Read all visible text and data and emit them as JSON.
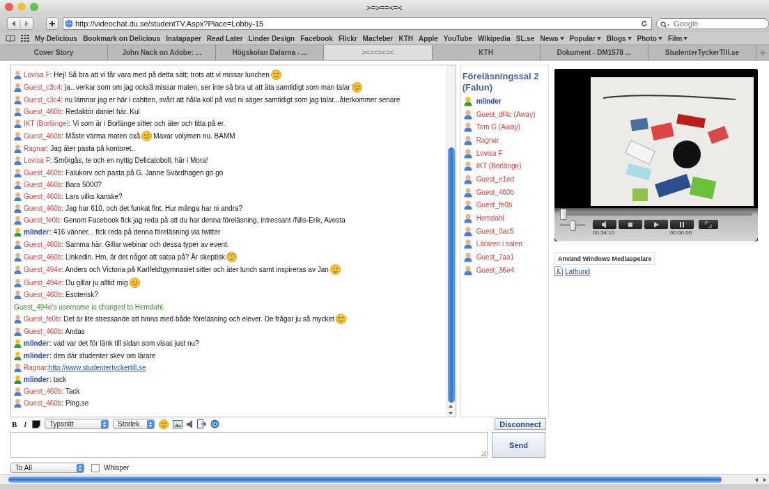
{
  "window": {
    "title": ">=>==<=<"
  },
  "toolbar": {
    "url": "http://videochat.du.se/studentTV.Aspx?Place=Lobby-15",
    "search_placeholder": "Google"
  },
  "bookmarks": [
    {
      "label": "My Delicious",
      "menu": false
    },
    {
      "label": "Bookmark on Delicious",
      "menu": false
    },
    {
      "label": "Instapaper",
      "menu": false
    },
    {
      "label": "Read Later",
      "menu": false
    },
    {
      "label": "Linder Design",
      "menu": false
    },
    {
      "label": "Facebook",
      "menu": false
    },
    {
      "label": "Flickr",
      "menu": false
    },
    {
      "label": "Macfeber",
      "menu": false
    },
    {
      "label": "KTH",
      "menu": false
    },
    {
      "label": "Apple",
      "menu": false
    },
    {
      "label": "YouTube",
      "menu": false
    },
    {
      "label": "Wikipedia",
      "menu": false
    },
    {
      "label": "SL.se",
      "menu": false
    },
    {
      "label": "News",
      "menu": true
    },
    {
      "label": "Popular",
      "menu": true
    },
    {
      "label": "Blogs",
      "menu": true
    },
    {
      "label": "Photo",
      "menu": true
    },
    {
      "label": "Film",
      "menu": true
    }
  ],
  "tabs": [
    {
      "label": "Cover Story",
      "selected": false
    },
    {
      "label": "John Nack on Adobe: ...",
      "selected": false
    },
    {
      "label": "Högskolan Dalarna - ...",
      "selected": false
    },
    {
      "label": ">=>==<=<",
      "selected": true
    },
    {
      "label": "KTH",
      "selected": false
    },
    {
      "label": "Dokument - DM1578 ...",
      "selected": false
    },
    {
      "label": "StudenterTyckerTill.se",
      "selected": false
    }
  ],
  "chat": {
    "messages": [
      {
        "kind": "guest",
        "user": "Lovisa F",
        "parts": [
          {
            "kind": "text",
            "text": ": Hej! Så bra att vi får vara med på detta sätt; trots att vi missar lunchen"
          },
          {
            "kind": "sad"
          }
        ]
      },
      {
        "kind": "guest",
        "user": "Guest_c3c4",
        "parts": [
          {
            "kind": "text",
            "text": ": ja...verkar som om jag också missar maten, ser inte så bra ut att äta samtidigt som man talar"
          },
          {
            "kind": "wink"
          }
        ]
      },
      {
        "kind": "guest",
        "user": "Guest_c3c4",
        "parts": [
          {
            "kind": "text",
            "text": ": nu lämnar jag er här i cahtten, svårt att hålla koll på vad ni säger samtidigt som jag talar...återkommer senare"
          }
        ]
      },
      {
        "kind": "guest",
        "user": "Guest_460b",
        "parts": [
          {
            "kind": "text",
            "text": ": Redaktör daniel här. Kul"
          }
        ]
      },
      {
        "kind": "guest",
        "user": "IKT (Borlänge)",
        "parts": [
          {
            "kind": "text",
            "text": ": Vi som är i Borlänge sitter och äter och titta på er."
          }
        ]
      },
      {
        "kind": "guest",
        "user": "Guest_460b",
        "parts": [
          {
            "kind": "text",
            "text": ": Måste värma maten oxå"
          },
          {
            "kind": "wink"
          },
          {
            "kind": "text",
            "text": "Maxar volymen nu. BAMM"
          }
        ]
      },
      {
        "kind": "guest",
        "user": "Ragnar",
        "parts": [
          {
            "kind": "text",
            "text": ": Jag äter pasta på kontoret.."
          }
        ]
      },
      {
        "kind": "guest",
        "user": "Lovisa F",
        "parts": [
          {
            "kind": "text",
            "text": ": Smörgås, te och en nyttig Delicatoboll, här i Mora!"
          }
        ]
      },
      {
        "kind": "guest",
        "user": "Guest_460b",
        "parts": [
          {
            "kind": "text",
            "text": ": Falukorv och pasta på G. Janne Svärdhagen go go"
          }
        ]
      },
      {
        "kind": "guest",
        "user": "Guest_460b",
        "parts": [
          {
            "kind": "text",
            "text": ": Bara 5000?"
          }
        ]
      },
      {
        "kind": "guest",
        "user": "Guest_460b",
        "parts": [
          {
            "kind": "text",
            "text": ": Lars vilks kanske?"
          }
        ]
      },
      {
        "kind": "guest",
        "user": "Guest_460b",
        "parts": [
          {
            "kind": "text",
            "text": ": Jag har 610, och det funkat fint. Hur många har ni andra?"
          }
        ]
      },
      {
        "kind": "guest",
        "user": "Guest_fe0b",
        "parts": [
          {
            "kind": "text",
            "text": ": Genom Facebook fick jag reda på att du har denna föreläsning, intressant /Nils-Erik, Avesta"
          }
        ]
      },
      {
        "kind": "host",
        "user": "mlinder",
        "parts": [
          {
            "kind": "text",
            "text": ": 416 vänner... fick reda på denna föreläsning via twitter"
          }
        ]
      },
      {
        "kind": "guest",
        "user": "Guest_460b",
        "parts": [
          {
            "kind": "text",
            "text": ": Samma här. Gillar webinar och dessa typer av event."
          }
        ]
      },
      {
        "kind": "guest",
        "user": "Guest_460b",
        "parts": [
          {
            "kind": "text",
            "text": ": Linkedin. Hm, är det något att satsa på? Är skeptisk"
          },
          {
            "kind": "eyeroll"
          }
        ]
      },
      {
        "kind": "guest",
        "user": "Guest_494e",
        "parts": [
          {
            "kind": "text",
            "text": ": Anders och Victoria på Karlfeldtgymnasiet sitter och äter lunch samt inspireras av Jan"
          },
          {
            "kind": "smile"
          }
        ]
      },
      {
        "kind": "guest",
        "user": "Guest_494e",
        "parts": [
          {
            "kind": "text",
            "text": ": Du gillar ju alltid mig"
          },
          {
            "kind": "wink"
          }
        ]
      },
      {
        "kind": "guest",
        "user": "Guest_460b",
        "parts": [
          {
            "kind": "text",
            "text": ": Esoterisk?"
          }
        ]
      },
      {
        "kind": "system",
        "text": "Guest_494e's username is changed to Hemdahl."
      },
      {
        "kind": "guest",
        "user": "Guest_fe0b",
        "parts": [
          {
            "kind": "text",
            "text": ": Det är lite stressande att hinna med både föreläsning och elever. De frågar ju så mycket"
          },
          {
            "kind": "smile"
          }
        ]
      },
      {
        "kind": "guest",
        "user": "Guest_460b",
        "parts": [
          {
            "kind": "text",
            "text": ": Andas"
          }
        ]
      },
      {
        "kind": "host",
        "user": "mlinder",
        "parts": [
          {
            "kind": "text",
            "text": ": vad var det för länk till sidan som visas just nu?"
          }
        ]
      },
      {
        "kind": "host",
        "user": "mlinder",
        "parts": [
          {
            "kind": "text",
            "text": ": den där studenter skev om lärare"
          }
        ]
      },
      {
        "kind": "guest",
        "user": "Ragnar",
        "parts": [
          {
            "kind": "text",
            "text": ":"
          },
          {
            "kind": "link",
            "text": "http://www.studentertyckertill.se"
          }
        ]
      },
      {
        "kind": "host",
        "user": "mlinder",
        "parts": [
          {
            "kind": "text",
            "text": ": tack"
          }
        ]
      },
      {
        "kind": "guest",
        "user": "Guest_460b",
        "parts": [
          {
            "kind": "text",
            "text": ": Tack"
          }
        ]
      },
      {
        "kind": "guest",
        "user": "Guest_460b",
        "parts": [
          {
            "kind": "text",
            "text": ": Ping.se"
          }
        ]
      }
    ]
  },
  "room": {
    "title": "Föreläsningssal 2 (Falun)",
    "users": [
      {
        "name": "mlinder",
        "kind": "host"
      },
      {
        "name": "Guest_df4c (Away)",
        "kind": "guest"
      },
      {
        "name": "Tom G (Away)",
        "kind": "guest"
      },
      {
        "name": "Ragnar",
        "kind": "guest"
      },
      {
        "name": "Lovisa F",
        "kind": "guest"
      },
      {
        "name": "IKT (Borlänge)",
        "kind": "guest"
      },
      {
        "name": "Guest_e1ed",
        "kind": "guest"
      },
      {
        "name": "Guest_460b",
        "kind": "guest"
      },
      {
        "name": "Guest_fe0b",
        "kind": "guest"
      },
      {
        "name": "Hemdahl",
        "kind": "guest"
      },
      {
        "name": "Guest_0ac5",
        "kind": "guest"
      },
      {
        "name": "Läraren i salen",
        "kind": "guest"
      },
      {
        "name": "Guest_7aa1",
        "kind": "guest"
      },
      {
        "name": "Guest_36e4",
        "kind": "guest"
      }
    ]
  },
  "video": {
    "position": "00:34:10",
    "duration": "00:00:00",
    "seek": {
      "level": 0.03
    },
    "volume": {
      "level": 0.5
    }
  },
  "media_player_button": "Använd Windows Mediaspelare",
  "guide_link": "Lathund",
  "composer": {
    "format_buttons": [
      "B",
      "I"
    ],
    "font": "Typsnitt",
    "size": "Storlek",
    "disconnect": "Disconnect",
    "send": "Send",
    "recipient": "To All",
    "whisper": {
      "label": "Whisper",
      "checked": false
    }
  }
}
